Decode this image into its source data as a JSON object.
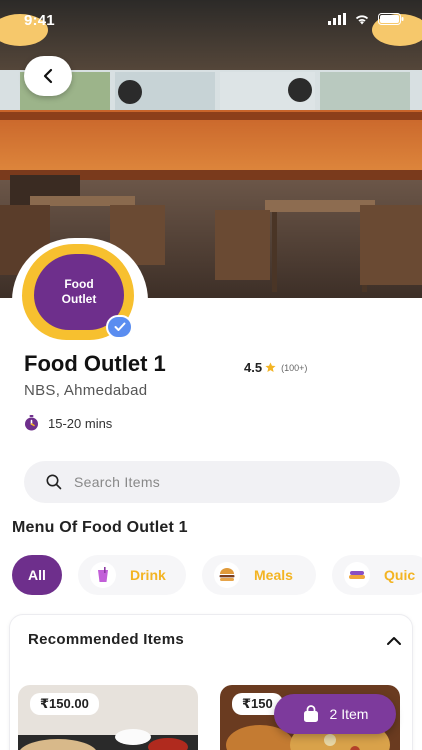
{
  "status_bar": {
    "time": "9:41"
  },
  "outlet": {
    "logo_line1": "Food",
    "logo_line2": "Outlet",
    "name": "Food Outlet 1",
    "rating": "4.5",
    "rating_count": "(100+)",
    "location": "NBS, Ahmedabad",
    "eta": "15-20 mins"
  },
  "search": {
    "placeholder": "Search Items"
  },
  "menu": {
    "title": "Menu Of Food Outlet 1",
    "categories": [
      {
        "label": "All",
        "icon": ""
      },
      {
        "label": "Drink",
        "icon": "drink-icon"
      },
      {
        "label": "Meals",
        "icon": "burger-icon"
      },
      {
        "label": "Quic",
        "icon": "snack-icon"
      }
    ]
  },
  "recommended": {
    "title": "Recommended Items",
    "items": [
      {
        "price": "₹150.00"
      },
      {
        "price": "₹150"
      }
    ]
  },
  "cart": {
    "label": "2 Item"
  },
  "colors": {
    "brand_purple": "#6e2f8c",
    "accent_yellow": "#f3b423",
    "verified_blue": "#5a8df0"
  }
}
